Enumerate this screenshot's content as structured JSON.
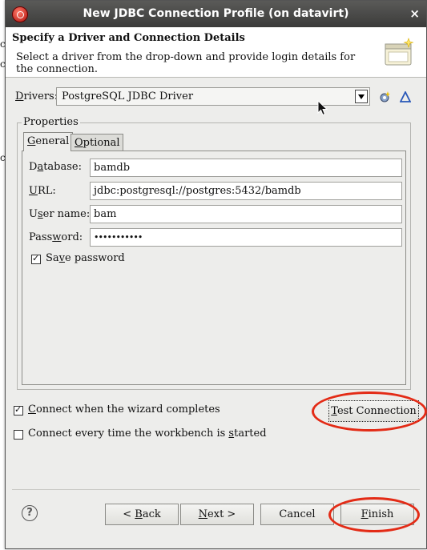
{
  "background": {
    "fragments": [
      "ance",
      "c",
      "c",
      "c"
    ]
  },
  "window": {
    "title": "New JDBC Connection Profile  (on datavirt)",
    "close_glyph": "×"
  },
  "header": {
    "heading": "Specify a Driver and Connection Details",
    "description": "Select a driver from the drop-down and provide login details for the connection."
  },
  "drivers": {
    "label_pre": "D",
    "label_rest": "rivers:",
    "selected": "PostgreSQL JDBC Driver",
    "new_icon": "new-driver-icon",
    "edit_icon": "edit-driver-icon"
  },
  "properties": {
    "group_label": "Properties",
    "tabs": [
      {
        "pre": "",
        "ul": "G",
        "post": "eneral",
        "active": true
      },
      {
        "pre": "",
        "ul": "O",
        "post": "ptional",
        "active": false
      }
    ],
    "fields": {
      "database": {
        "pre": "D",
        "ul": "a",
        "post": "tabase:",
        "value": "bamdb"
      },
      "url": {
        "pre": "",
        "ul": "U",
        "post": "RL:",
        "value": "jdbc:postgresql://postgres:5432/bamdb"
      },
      "username": {
        "pre": "U",
        "ul": "s",
        "post": "er name:",
        "value": "bam"
      },
      "password": {
        "pre": "Pass",
        "ul": "w",
        "post": "ord:",
        "value": "•••••••••••"
      }
    },
    "save_password": {
      "pre": "Sa",
      "ul": "v",
      "post": "e password",
      "checked": true
    }
  },
  "options": {
    "connect_on_finish": {
      "pre": "",
      "ul": "C",
      "post": "onnect when the wizard completes",
      "checked": true
    },
    "connect_every_time": {
      "pre": "Connect every time the workbench is ",
      "ul": "s",
      "post": "tarted",
      "checked": false
    }
  },
  "buttons": {
    "test_connection": {
      "ul": "T",
      "post": "est Connection"
    },
    "back": {
      "pre": "< ",
      "ul": "B",
      "post": "ack"
    },
    "next": {
      "ul": "N",
      "post": "ext >"
    },
    "cancel": "Cancel",
    "finish": {
      "ul": "F",
      "post": "inish"
    },
    "help_glyph": "?"
  },
  "colors": {
    "highlight": "#e32b16",
    "titlebar": "#3b3b3a",
    "dialog_bg": "#ededeb"
  }
}
